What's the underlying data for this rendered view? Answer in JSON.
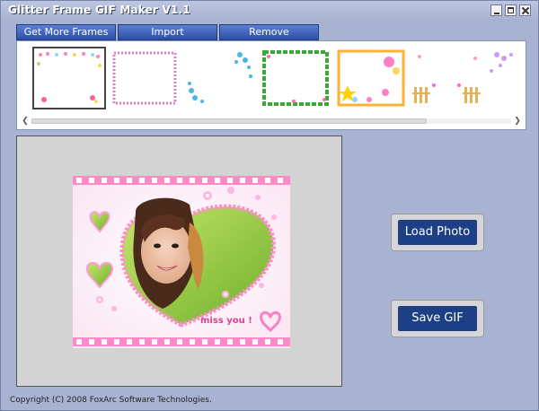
{
  "window": {
    "title": "Glitter Frame GIF Maker V1.1"
  },
  "tabs": [
    "Get More Frames",
    "Import",
    "Remove"
  ],
  "frames": [
    {
      "name": "frame-1-dots",
      "selected": true
    },
    {
      "name": "frame-2-pink-border",
      "selected": false
    },
    {
      "name": "frame-3-blue-corner",
      "selected": false
    },
    {
      "name": "frame-4-green-vines",
      "selected": false
    },
    {
      "name": "frame-5-flowers-star",
      "selected": false
    },
    {
      "name": "frame-6-fence",
      "selected": false
    },
    {
      "name": "frame-7-purple",
      "selected": false
    }
  ],
  "scrollbar": {
    "position": 0.0
  },
  "preview": {
    "caption": "miss you !"
  },
  "buttons": {
    "load": "Load Photo",
    "save": "Save GIF"
  },
  "footer": "Copyright (C) 2008 FoxArc Software Technologies.",
  "colors": {
    "window_bg": "#a8b3d1",
    "button_blue": "#1c3f86",
    "tab_blue": "#3b5fb8"
  }
}
